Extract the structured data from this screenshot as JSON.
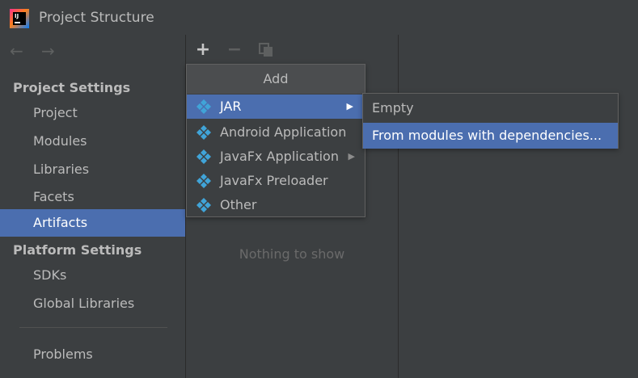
{
  "window": {
    "title": "Project Structure",
    "logo_text": "IJ"
  },
  "nav": {
    "back_glyph": "←",
    "forward_glyph": "→"
  },
  "sidebar": {
    "project_settings": {
      "header": "Project Settings",
      "items": [
        {
          "label": "Project"
        },
        {
          "label": "Modules"
        },
        {
          "label": "Libraries"
        },
        {
          "label": "Facets"
        },
        {
          "label": "Artifacts",
          "selected": true
        }
      ]
    },
    "platform_settings": {
      "header": "Platform Settings",
      "items": [
        {
          "label": "SDKs"
        },
        {
          "label": "Global Libraries"
        }
      ]
    },
    "problems": {
      "label": "Problems"
    }
  },
  "toolbar": {
    "add_glyph": "+",
    "remove_glyph": "−"
  },
  "artifacts": {
    "empty_text": "Nothing to show"
  },
  "add_popup": {
    "title": "Add",
    "items": [
      {
        "label": "JAR",
        "has_submenu": true,
        "hover": true
      },
      {
        "label": "Android Application",
        "has_submenu": false
      },
      {
        "label": "JavaFx Application",
        "has_submenu": true
      },
      {
        "label": "JavaFx Preloader",
        "has_submenu": false
      },
      {
        "label": "Other",
        "has_submenu": false
      }
    ],
    "submenu_arrow": "▶"
  },
  "jar_submenu": {
    "items": [
      {
        "label": "Empty"
      },
      {
        "label": "From modules with dependencies...",
        "hover": true
      }
    ]
  },
  "colors": {
    "background": "#3c3f41",
    "selection": "#4b6eaf",
    "text": "#bbbbbb",
    "muted_text": "#6a6a6a",
    "icon_blue": "#40a4d8"
  }
}
